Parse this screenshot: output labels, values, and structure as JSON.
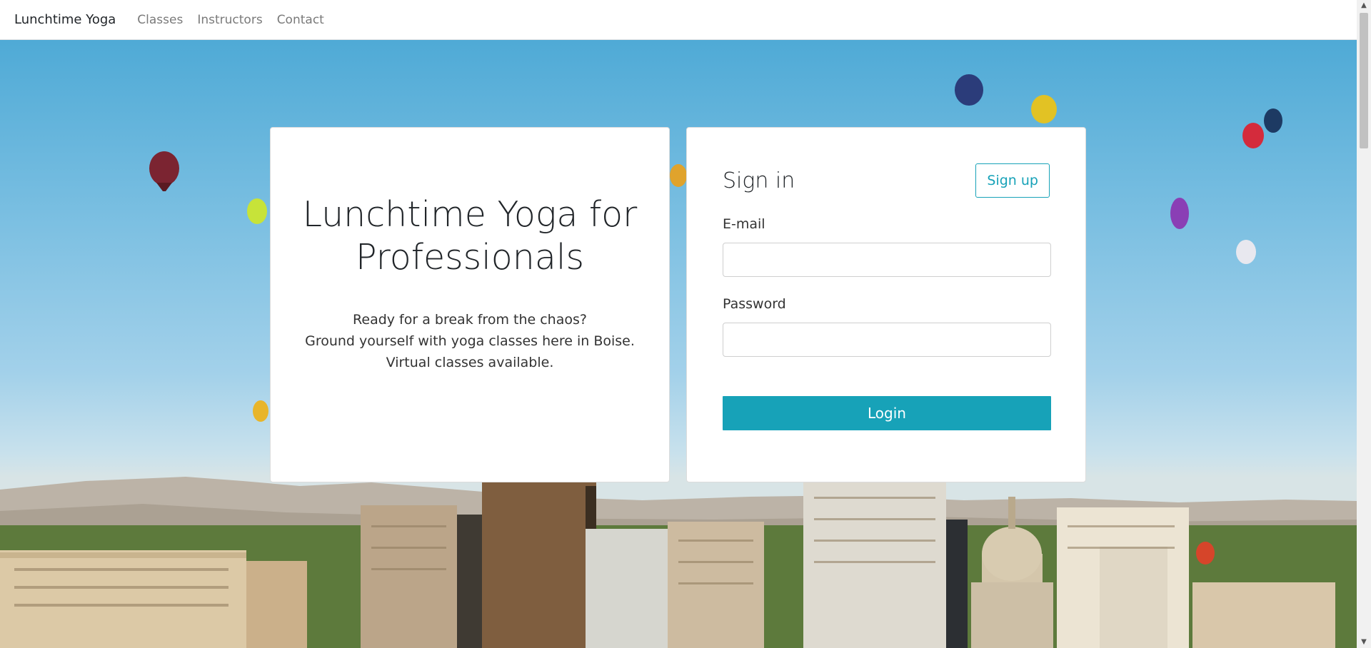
{
  "nav": {
    "brand": "Lunchtime Yoga",
    "links": [
      "Classes",
      "Instructors",
      "Contact"
    ]
  },
  "intro": {
    "title": "Lunchtime Yoga for Professionals",
    "lines": [
      "Ready for a break from the chaos?",
      "Ground yourself with yoga classes here in Boise.",
      "Virtual classes available."
    ]
  },
  "login": {
    "title": "Sign in",
    "signup_label": "Sign up",
    "email_label": "E-mail",
    "email_value": "",
    "password_label": "Password",
    "password_value": "",
    "submit_label": "Login"
  },
  "colors": {
    "accent": "#17a2b8",
    "sky_top": "#4faad6",
    "sky_bottom": "#d8e4e6"
  }
}
